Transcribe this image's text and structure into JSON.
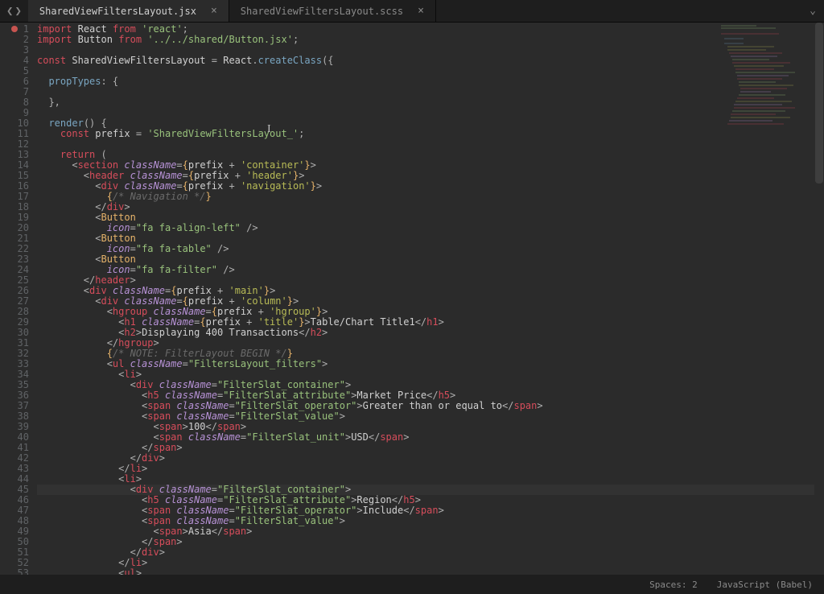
{
  "tabs": [
    {
      "label": "SharedViewFiltersLayout.jsx",
      "active": true
    },
    {
      "label": "SharedViewFiltersLayout.scss",
      "active": false
    }
  ],
  "status": {
    "indent": "Spaces: 2",
    "language": "JavaScript (Babel)"
  },
  "gutter": {
    "count": 53,
    "breakpointLine": 1,
    "highlightLine": 45
  },
  "code": {
    "lines": [
      [
        [
          "kw",
          "import"
        ],
        [
          "pun",
          " "
        ],
        [
          "id",
          "React"
        ],
        [
          "pun",
          " "
        ],
        [
          "kw",
          "from"
        ],
        [
          "pun",
          " "
        ],
        [
          "str",
          "'react'"
        ],
        [
          "pun",
          ";"
        ]
      ],
      [
        [
          "kw",
          "import"
        ],
        [
          "pun",
          " "
        ],
        [
          "id",
          "Button"
        ],
        [
          "pun",
          " "
        ],
        [
          "kw",
          "from"
        ],
        [
          "pun",
          " "
        ],
        [
          "str",
          "'../../shared/Button.jsx'"
        ],
        [
          "pun",
          ";"
        ]
      ],
      [],
      [
        [
          "kw",
          "const"
        ],
        [
          "pun",
          " "
        ],
        [
          "cls",
          "SharedViewFiltersLayout"
        ],
        [
          "pun",
          " = "
        ],
        [
          "id",
          "React"
        ],
        [
          "pun",
          "."
        ],
        [
          "fn",
          "createClass"
        ],
        [
          "pun",
          "({"
        ]
      ],
      [],
      [
        [
          "pun",
          "  "
        ],
        [
          "fn",
          "propTypes"
        ],
        [
          "pun",
          ": {"
        ]
      ],
      [],
      [
        [
          "pun",
          "  },"
        ]
      ],
      [],
      [
        [
          "pun",
          "  "
        ],
        [
          "fn",
          "render"
        ],
        [
          "pun",
          "() {"
        ]
      ],
      [
        [
          "pun",
          "    "
        ],
        [
          "kw",
          "const"
        ],
        [
          "pun",
          " "
        ],
        [
          "id",
          "prefix"
        ],
        [
          "pun",
          " = "
        ],
        [
          "str",
          "'SharedViewFiltersLayout_'"
        ],
        [
          "pun",
          ";"
        ]
      ],
      [],
      [
        [
          "pun",
          "    "
        ],
        [
          "kw",
          "return"
        ],
        [
          "pun",
          " ("
        ]
      ],
      [
        [
          "pun",
          "      <"
        ],
        [
          "tag",
          "section"
        ],
        [
          "pun",
          " "
        ],
        [
          "attr",
          "className"
        ],
        [
          "pun",
          "="
        ],
        [
          "br",
          "{"
        ],
        [
          "id",
          "prefix"
        ],
        [
          "pun",
          " + "
        ],
        [
          "str2",
          "'container'"
        ],
        [
          "br",
          "}"
        ],
        [
          "pun",
          ">"
        ]
      ],
      [
        [
          "pun",
          "        <"
        ],
        [
          "tag",
          "header"
        ],
        [
          "pun",
          " "
        ],
        [
          "attr",
          "className"
        ],
        [
          "pun",
          "="
        ],
        [
          "br",
          "{"
        ],
        [
          "id",
          "prefix"
        ],
        [
          "pun",
          " + "
        ],
        [
          "str2",
          "'header'"
        ],
        [
          "br",
          "}"
        ],
        [
          "pun",
          ">"
        ]
      ],
      [
        [
          "pun",
          "          <"
        ],
        [
          "tag",
          "div"
        ],
        [
          "pun",
          " "
        ],
        [
          "attr",
          "className"
        ],
        [
          "pun",
          "="
        ],
        [
          "br",
          "{"
        ],
        [
          "id",
          "prefix"
        ],
        [
          "pun",
          " + "
        ],
        [
          "str2",
          "'navigation'"
        ],
        [
          "br",
          "}"
        ],
        [
          "pun",
          ">"
        ]
      ],
      [
        [
          "pun",
          "            "
        ],
        [
          "br",
          "{"
        ],
        [
          "cmt",
          "/* Navigation */"
        ],
        [
          "br",
          "}"
        ]
      ],
      [
        [
          "pun",
          "          </"
        ],
        [
          "tag",
          "div"
        ],
        [
          "pun",
          ">"
        ]
      ],
      [
        [
          "pun",
          "          <"
        ],
        [
          "tagc",
          "Button"
        ]
      ],
      [
        [
          "pun",
          "            "
        ],
        [
          "attr",
          "icon"
        ],
        [
          "pun",
          "="
        ],
        [
          "str",
          "\"fa fa-align-left\""
        ],
        [
          "pun",
          " />"
        ]
      ],
      [
        [
          "pun",
          "          <"
        ],
        [
          "tagc",
          "Button"
        ]
      ],
      [
        [
          "pun",
          "            "
        ],
        [
          "attr",
          "icon"
        ],
        [
          "pun",
          "="
        ],
        [
          "str",
          "\"fa fa-table\""
        ],
        [
          "pun",
          " />"
        ]
      ],
      [
        [
          "pun",
          "          <"
        ],
        [
          "tagc",
          "Button"
        ]
      ],
      [
        [
          "pun",
          "            "
        ],
        [
          "attr",
          "icon"
        ],
        [
          "pun",
          "="
        ],
        [
          "str",
          "\"fa fa-filter\""
        ],
        [
          "pun",
          " />"
        ]
      ],
      [
        [
          "pun",
          "        </"
        ],
        [
          "tag",
          "header"
        ],
        [
          "pun",
          ">"
        ]
      ],
      [
        [
          "pun",
          "        <"
        ],
        [
          "tag",
          "div"
        ],
        [
          "pun",
          " "
        ],
        [
          "attr",
          "className"
        ],
        [
          "pun",
          "="
        ],
        [
          "br",
          "{"
        ],
        [
          "id",
          "prefix"
        ],
        [
          "pun",
          " + "
        ],
        [
          "str2",
          "'main'"
        ],
        [
          "br",
          "}"
        ],
        [
          "pun",
          ">"
        ]
      ],
      [
        [
          "pun",
          "          <"
        ],
        [
          "tag",
          "div"
        ],
        [
          "pun",
          " "
        ],
        [
          "attr",
          "className"
        ],
        [
          "pun",
          "="
        ],
        [
          "br",
          "{"
        ],
        [
          "id",
          "prefix"
        ],
        [
          "pun",
          " + "
        ],
        [
          "str2",
          "'column'"
        ],
        [
          "br",
          "}"
        ],
        [
          "pun",
          ">"
        ]
      ],
      [
        [
          "pun",
          "            <"
        ],
        [
          "tag",
          "hgroup"
        ],
        [
          "pun",
          " "
        ],
        [
          "attr",
          "className"
        ],
        [
          "pun",
          "="
        ],
        [
          "br",
          "{"
        ],
        [
          "id",
          "prefix"
        ],
        [
          "pun",
          " + "
        ],
        [
          "str2",
          "'hgroup'"
        ],
        [
          "br",
          "}"
        ],
        [
          "pun",
          ">"
        ]
      ],
      [
        [
          "pun",
          "              <"
        ],
        [
          "tag",
          "h1"
        ],
        [
          "pun",
          " "
        ],
        [
          "attr",
          "className"
        ],
        [
          "pun",
          "="
        ],
        [
          "br",
          "{"
        ],
        [
          "id",
          "prefix"
        ],
        [
          "pun",
          " + "
        ],
        [
          "str2",
          "'title'"
        ],
        [
          "br",
          "}"
        ],
        [
          "pun",
          ">"
        ],
        [
          "id",
          "Table/Chart Title1"
        ],
        [
          "pun",
          "</"
        ],
        [
          "tag",
          "h1"
        ],
        [
          "pun",
          ">"
        ]
      ],
      [
        [
          "pun",
          "              <"
        ],
        [
          "tag",
          "h2"
        ],
        [
          "pun",
          ">"
        ],
        [
          "id",
          "Displaying 400 Transactions"
        ],
        [
          "pun",
          "</"
        ],
        [
          "tag",
          "h2"
        ],
        [
          "pun",
          ">"
        ]
      ],
      [
        [
          "pun",
          "            </"
        ],
        [
          "tag",
          "hgroup"
        ],
        [
          "pun",
          ">"
        ]
      ],
      [
        [
          "pun",
          "            "
        ],
        [
          "br",
          "{"
        ],
        [
          "cmt",
          "/* NOTE: FilterLayout BEGIN */"
        ],
        [
          "br",
          "}"
        ]
      ],
      [
        [
          "pun",
          "            <"
        ],
        [
          "tag",
          "ul"
        ],
        [
          "pun",
          " "
        ],
        [
          "attr",
          "className"
        ],
        [
          "pun",
          "="
        ],
        [
          "str",
          "\"FiltersLayout_filters\""
        ],
        [
          "pun",
          ">"
        ]
      ],
      [
        [
          "pun",
          "              <"
        ],
        [
          "tag",
          "li"
        ],
        [
          "pun",
          ">"
        ]
      ],
      [
        [
          "pun",
          "                <"
        ],
        [
          "tag",
          "div"
        ],
        [
          "pun",
          " "
        ],
        [
          "attr",
          "className"
        ],
        [
          "pun",
          "="
        ],
        [
          "str",
          "\"FilterSlat_container\""
        ],
        [
          "pun",
          ">"
        ]
      ],
      [
        [
          "pun",
          "                  <"
        ],
        [
          "tag",
          "h5"
        ],
        [
          "pun",
          " "
        ],
        [
          "attr",
          "className"
        ],
        [
          "pun",
          "="
        ],
        [
          "str",
          "\"FilterSlat_attribute\""
        ],
        [
          "pun",
          ">"
        ],
        [
          "id",
          "Market Price"
        ],
        [
          "pun",
          "</"
        ],
        [
          "tag",
          "h5"
        ],
        [
          "pun",
          ">"
        ]
      ],
      [
        [
          "pun",
          "                  <"
        ],
        [
          "tag",
          "span"
        ],
        [
          "pun",
          " "
        ],
        [
          "attr",
          "className"
        ],
        [
          "pun",
          "="
        ],
        [
          "str",
          "\"FilterSlat_operator\""
        ],
        [
          "pun",
          ">"
        ],
        [
          "id",
          "Greater than or equal to"
        ],
        [
          "pun",
          "</"
        ],
        [
          "tag",
          "span"
        ],
        [
          "pun",
          ">"
        ]
      ],
      [
        [
          "pun",
          "                  <"
        ],
        [
          "tag",
          "span"
        ],
        [
          "pun",
          " "
        ],
        [
          "attr",
          "className"
        ],
        [
          "pun",
          "="
        ],
        [
          "str",
          "\"FilterSlat_value\""
        ],
        [
          "pun",
          ">"
        ]
      ],
      [
        [
          "pun",
          "                    <"
        ],
        [
          "tag",
          "span"
        ],
        [
          "pun",
          ">"
        ],
        [
          "id",
          "100"
        ],
        [
          "pun",
          "</"
        ],
        [
          "tag",
          "span"
        ],
        [
          "pun",
          ">"
        ]
      ],
      [
        [
          "pun",
          "                    <"
        ],
        [
          "tag",
          "span"
        ],
        [
          "pun",
          " "
        ],
        [
          "attr",
          "className"
        ],
        [
          "pun",
          "="
        ],
        [
          "str",
          "\"FilterSlat_unit\""
        ],
        [
          "pun",
          ">"
        ],
        [
          "id",
          "USD"
        ],
        [
          "pun",
          "</"
        ],
        [
          "tag",
          "span"
        ],
        [
          "pun",
          ">"
        ]
      ],
      [
        [
          "pun",
          "                  </"
        ],
        [
          "tag",
          "span"
        ],
        [
          "pun",
          ">"
        ]
      ],
      [
        [
          "pun",
          "                </"
        ],
        [
          "tag",
          "div"
        ],
        [
          "pun",
          ">"
        ]
      ],
      [
        [
          "pun",
          "              </"
        ],
        [
          "tag",
          "li"
        ],
        [
          "pun",
          ">"
        ]
      ],
      [
        [
          "pun",
          "              <"
        ],
        [
          "tag",
          "li"
        ],
        [
          "pun",
          ">"
        ]
      ],
      [
        [
          "pun",
          "                <"
        ],
        [
          "tag",
          "div"
        ],
        [
          "pun",
          " "
        ],
        [
          "attr",
          "className"
        ],
        [
          "pun",
          "="
        ],
        [
          "str",
          "\"FilterSlat_container\""
        ],
        [
          "pun",
          ">"
        ]
      ],
      [
        [
          "pun",
          "                  <"
        ],
        [
          "tag",
          "h5"
        ],
        [
          "pun",
          " "
        ],
        [
          "attr",
          "className"
        ],
        [
          "pun",
          "="
        ],
        [
          "str",
          "\"FilterSlat_attribute\""
        ],
        [
          "pun",
          ">"
        ],
        [
          "id",
          "Region"
        ],
        [
          "pun",
          "</"
        ],
        [
          "tag",
          "h5"
        ],
        [
          "pun",
          ">"
        ]
      ],
      [
        [
          "pun",
          "                  <"
        ],
        [
          "tag",
          "span"
        ],
        [
          "pun",
          " "
        ],
        [
          "attr",
          "className"
        ],
        [
          "pun",
          "="
        ],
        [
          "str",
          "\"FilterSlat_operator\""
        ],
        [
          "pun",
          ">"
        ],
        [
          "id",
          "Include"
        ],
        [
          "pun",
          "</"
        ],
        [
          "tag",
          "span"
        ],
        [
          "pun",
          ">"
        ]
      ],
      [
        [
          "pun",
          "                  <"
        ],
        [
          "tag",
          "span"
        ],
        [
          "pun",
          " "
        ],
        [
          "attr",
          "className"
        ],
        [
          "pun",
          "="
        ],
        [
          "str",
          "\"FilterSlat_value\""
        ],
        [
          "pun",
          ">"
        ]
      ],
      [
        [
          "pun",
          "                    <"
        ],
        [
          "tag",
          "span"
        ],
        [
          "pun",
          ">"
        ],
        [
          "id",
          "Asia"
        ],
        [
          "pun",
          "</"
        ],
        [
          "tag",
          "span"
        ],
        [
          "pun",
          ">"
        ]
      ],
      [
        [
          "pun",
          "                  </"
        ],
        [
          "tag",
          "span"
        ],
        [
          "pun",
          ">"
        ]
      ],
      [
        [
          "pun",
          "                </"
        ],
        [
          "tag",
          "div"
        ],
        [
          "pun",
          ">"
        ]
      ],
      [
        [
          "pun",
          "              </"
        ],
        [
          "tag",
          "li"
        ],
        [
          "pun",
          ">"
        ]
      ],
      [
        [
          "pun",
          "              <"
        ],
        [
          "tag",
          "ul"
        ],
        [
          "pun",
          ">"
        ]
      ]
    ]
  }
}
